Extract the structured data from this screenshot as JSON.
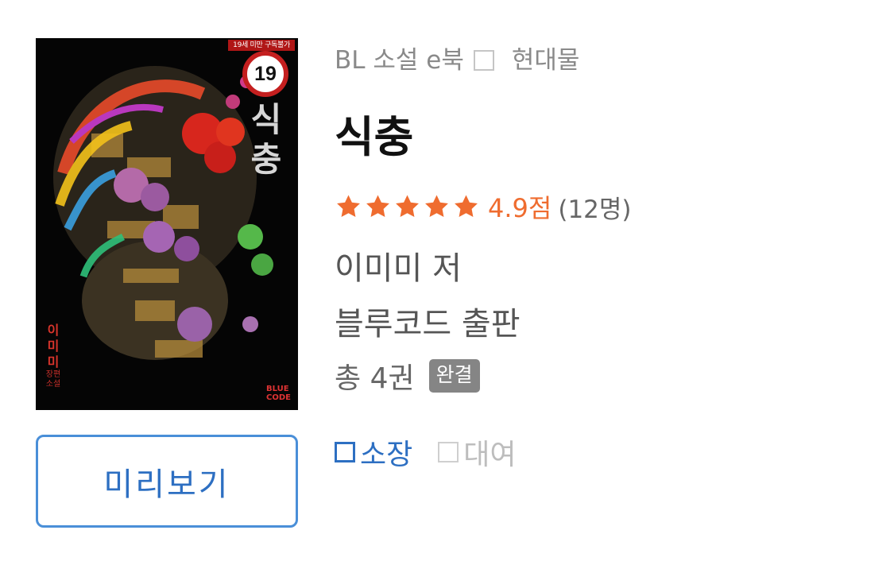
{
  "cover": {
    "age_banner": "19세 미만 구독불가",
    "age_badge": "19",
    "title_vertical": "식충",
    "author_vertical": "이미미",
    "genre_vertical": "장편소설",
    "publisher_logo": "BLUE CODE"
  },
  "preview_button": {
    "label": "미리보기"
  },
  "book": {
    "category": "BL 소설 e북",
    "subcategory": "현대물",
    "title": "식충",
    "rating": {
      "stars_filled": 5,
      "stars_total": 5,
      "score_text": "4.9점",
      "count_text": "(12명)",
      "color": "#ef6c2f"
    },
    "author_line": "이미미 저",
    "publisher_line": "블루코드 출판",
    "volumes_text": "총 4권",
    "status_badge": "완결"
  },
  "purchase_options": {
    "buy_label": "소장",
    "rent_label": "대여",
    "accent_color": "#2d6fc2"
  },
  "icons": {
    "star": "star-icon",
    "category_separator": "square-separator-icon",
    "checkbox": "checkbox-icon"
  }
}
